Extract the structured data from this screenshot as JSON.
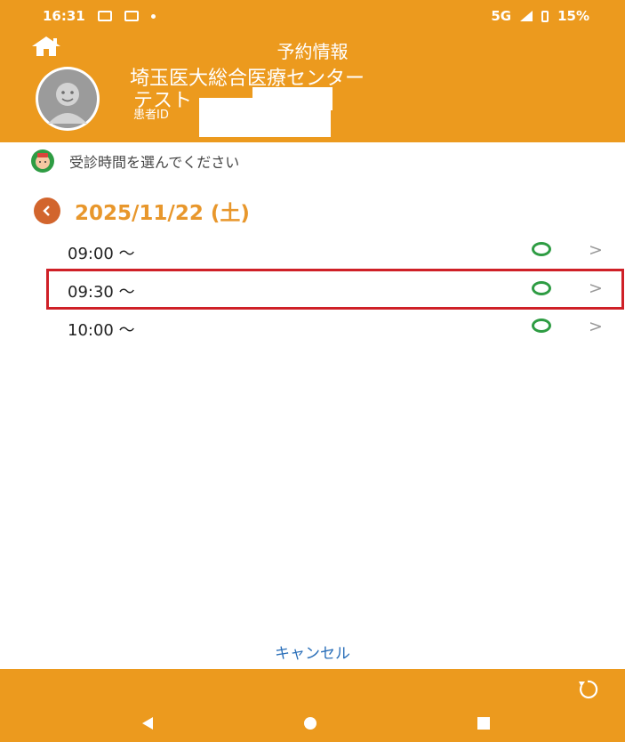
{
  "status_bar": {
    "time": "16:31",
    "network": "5G",
    "battery": "15%"
  },
  "header": {
    "title": "予約情報",
    "hospital": "埼玉医大総合医療センター",
    "patient_name": "テスト",
    "patient_id_label": "患者ID"
  },
  "guide": {
    "text": "受診時間を選んでください"
  },
  "date": {
    "label": "2025/11/22 (土)"
  },
  "slots": [
    {
      "time": "09:00 〜",
      "mark": "○",
      "selected": false
    },
    {
      "time": "09:30 〜",
      "mark": "○",
      "selected": true
    },
    {
      "time": "10:00 〜",
      "mark": "○",
      "selected": false
    }
  ],
  "chevron": ">",
  "footer": {
    "cancel": "キャンセル"
  },
  "colors": {
    "header": "#ec9a1e",
    "date": "#e8972c",
    "available": "#2e9c43",
    "selected_border": "#cf2027",
    "link": "#2a6fb9"
  }
}
